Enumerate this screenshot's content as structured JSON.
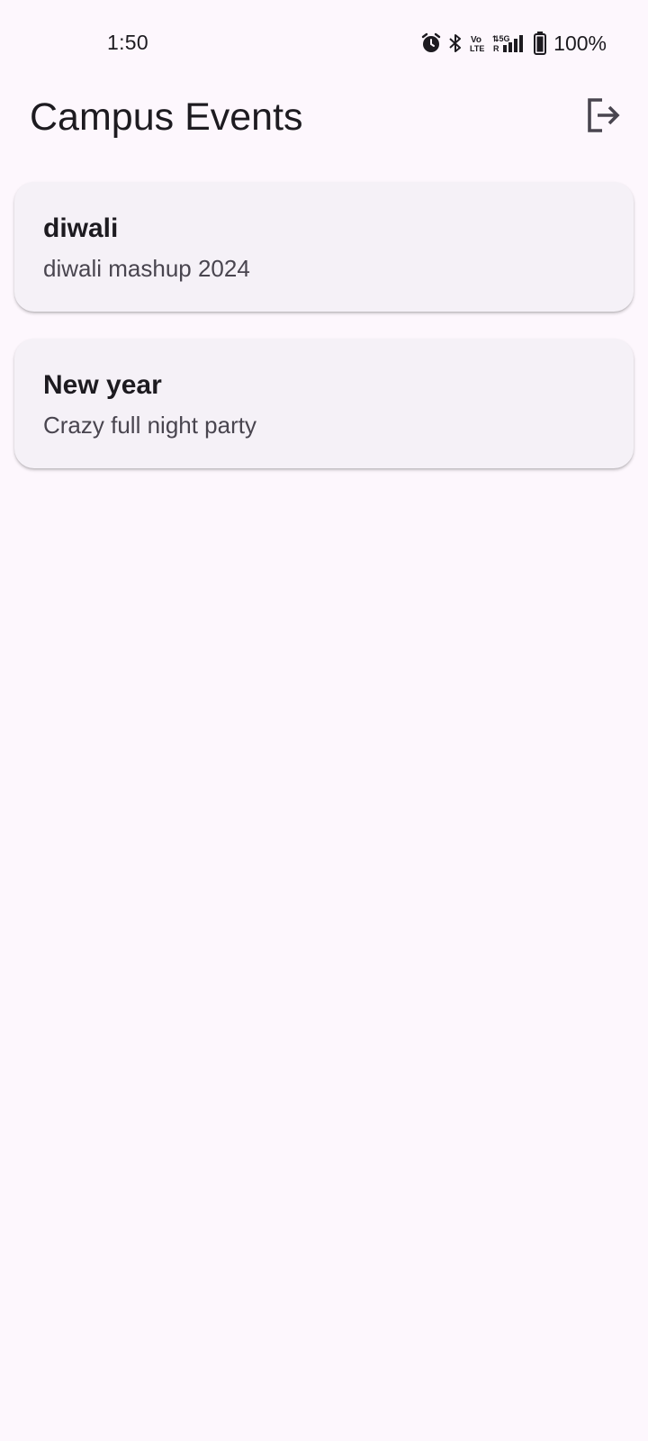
{
  "status_bar": {
    "time": "1:50",
    "battery": "100%",
    "icons": [
      "alarm-icon",
      "bluetooth-icon",
      "volte-icon",
      "5g-signal-icon",
      "battery-icon"
    ]
  },
  "app_bar": {
    "title": "Campus Events",
    "logout_icon": "logout-icon"
  },
  "events": [
    {
      "title": "diwali",
      "subtitle": "diwali mashup 2024"
    },
    {
      "title": "New year",
      "subtitle": "Crazy full night party"
    }
  ],
  "colors": {
    "background": "#fdf7fd",
    "card": "#f5f1f7",
    "text_primary": "#1d1b20",
    "text_secondary": "#49454f"
  }
}
